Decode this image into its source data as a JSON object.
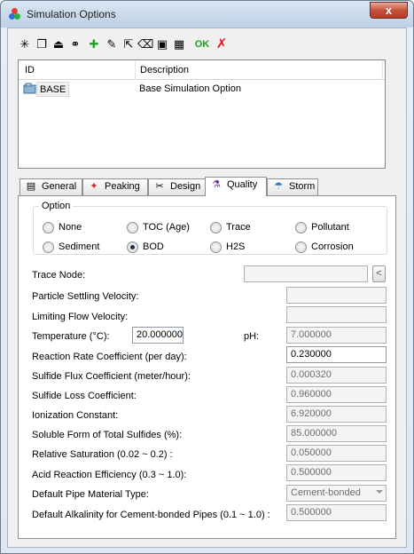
{
  "window": {
    "title": "Simulation Options",
    "close_symbol": "x"
  },
  "toolbar": {
    "buttons": [
      {
        "icon": "new-icon"
      },
      {
        "icon": "copy-icon"
      },
      {
        "icon": "import-icon"
      },
      {
        "icon": "link-icon"
      },
      {
        "icon": "add-icon"
      },
      {
        "icon": "edit-icon"
      },
      {
        "icon": "export-icon"
      },
      {
        "icon": "erase-icon"
      },
      {
        "icon": "save-icon"
      },
      {
        "icon": "save-all-icon"
      }
    ],
    "ok_label": "OK",
    "cancel_label": "✗"
  },
  "list": {
    "columns": [
      "ID",
      "Description"
    ],
    "rows": [
      {
        "id": "BASE",
        "description": "Base Simulation Option"
      }
    ]
  },
  "tabs": [
    {
      "label": "General",
      "icon": "general-icon",
      "active": false
    },
    {
      "label": "Peaking",
      "icon": "peaking-icon",
      "active": false
    },
    {
      "label": "Design",
      "icon": "design-icon",
      "active": false
    },
    {
      "label": "Quality",
      "icon": "quality-icon",
      "active": true
    },
    {
      "label": "Storm",
      "icon": "storm-icon",
      "active": false
    }
  ],
  "option_group": {
    "legend": "Option",
    "options": [
      {
        "label": "None",
        "selected": false
      },
      {
        "label": "TOC (Age)",
        "selected": false
      },
      {
        "label": "Trace",
        "selected": false
      },
      {
        "label": "Pollutant",
        "selected": false
      },
      {
        "label": "Sediment",
        "selected": false
      },
      {
        "label": "BOD",
        "selected": true
      },
      {
        "label": "H2S",
        "selected": false
      },
      {
        "label": "Corrosion",
        "selected": false
      }
    ]
  },
  "fields": {
    "trace_node": {
      "label": "Trace Node:",
      "value": "",
      "button": "<"
    },
    "particle_settling_velocity": {
      "label": "Particle Settling Velocity:",
      "value": ""
    },
    "limiting_flow_velocity": {
      "label": "Limiting Flow Velocity:",
      "value": ""
    },
    "temperature": {
      "label": "Temperature (°C):",
      "value": "20.000000"
    },
    "ph": {
      "label": "pH:",
      "value": "7.000000"
    },
    "reaction_rate_coefficient": {
      "label": "Reaction Rate Coefficient (per day):",
      "value": "0.230000"
    },
    "sulfide_flux_coefficient": {
      "label": "Sulfide Flux Coefficient (meter/hour):",
      "value": "0.000320"
    },
    "sulfide_loss_coefficient": {
      "label": "Sulfide Loss Coefficient:",
      "value": "0.960000"
    },
    "ionization_constant": {
      "label": "Ionization Constant:",
      "value": "6.920000"
    },
    "soluble_form": {
      "label": "Soluble Form of Total Sulfides (%):",
      "value": "85.000000"
    },
    "relative_saturation": {
      "label": "Relative Saturation (0.02 ~ 0.2) :",
      "value": "0.050000"
    },
    "acid_reaction_efficiency": {
      "label": "Acid Reaction Efficiency (0.3 ~ 1.0):",
      "value": "0.500000"
    },
    "default_pipe_material": {
      "label": "Default Pipe Material Type:",
      "value": "Cement-bonded"
    },
    "default_alkalinity": {
      "label": "Default Alkalinity for Cement-bonded Pipes (0.1 ~ 1.0) :",
      "value": "0.500000"
    }
  }
}
